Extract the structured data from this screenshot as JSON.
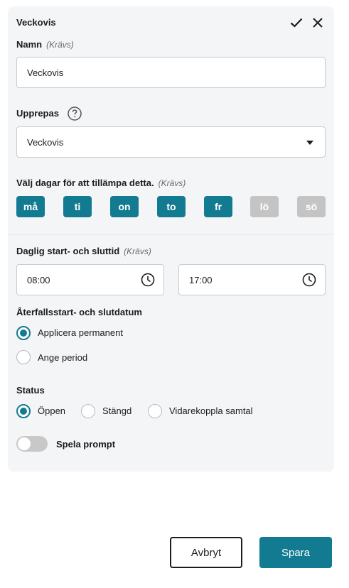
{
  "header": {
    "title": "Veckovis",
    "confirm_icon": "check-icon",
    "close_icon": "close-icon"
  },
  "name": {
    "label": "Namn",
    "required": "(Krävs)",
    "value": "Veckovis"
  },
  "repeat": {
    "label": "Upprepas",
    "help_icon": "question-circle-icon",
    "selected": "Veckovis"
  },
  "days": {
    "label": "Välj dagar för att tillämpa detta.",
    "required": "(Krävs)",
    "items": [
      {
        "label": "må",
        "selected": true
      },
      {
        "label": "ti",
        "selected": true
      },
      {
        "label": "on",
        "selected": true
      },
      {
        "label": "to",
        "selected": true
      },
      {
        "label": "fr",
        "selected": true
      },
      {
        "label": "lö",
        "selected": false
      },
      {
        "label": "sö",
        "selected": false
      }
    ]
  },
  "times": {
    "label": "Daglig start- och sluttid",
    "required": "(Krävs)",
    "start": "08:00",
    "end": "17:00",
    "clock_icon": "clock-icon"
  },
  "recurrence": {
    "label": "Återfallsstart- och slutdatum",
    "options": [
      {
        "label": "Applicera permanent",
        "checked": true
      },
      {
        "label": "Ange period",
        "checked": false
      }
    ]
  },
  "status": {
    "label": "Status",
    "options": [
      {
        "label": "Öppen",
        "checked": true
      },
      {
        "label": "Stängd",
        "checked": false
      },
      {
        "label": "Vidarekoppla samtal",
        "checked": false
      }
    ]
  },
  "prompt": {
    "label": "Spela prompt",
    "on": false
  },
  "footer": {
    "cancel": "Avbryt",
    "save": "Spara"
  },
  "colors": {
    "accent": "#137b91",
    "disabled_day": "#c4c4c4",
    "panel_bg": "#f4f5f7"
  }
}
